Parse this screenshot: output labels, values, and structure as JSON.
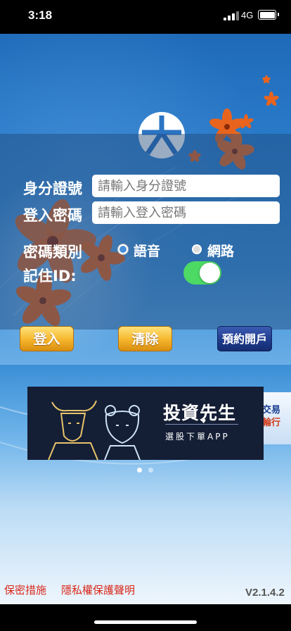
{
  "status_bar": {
    "time": "3:18",
    "network": "4G"
  },
  "login": {
    "id_label": "身分證號",
    "id_placeholder": "請輸入身分證號",
    "password_label": "登入密碼",
    "password_placeholder": "請輸入登入密碼",
    "password_type_label": "密碼類別",
    "password_type_options": [
      {
        "label": "語音",
        "selected": true
      },
      {
        "label": "網路",
        "selected": false
      }
    ],
    "remember_id_label": "記住ID:",
    "remember_id_on": true
  },
  "buttons": {
    "login": "登入",
    "clear": "清除",
    "book_account": "預約開戶"
  },
  "banner": {
    "title": "投資先生",
    "subtitle": "選股下單APP"
  },
  "side_card": {
    "line1": "交易",
    "line2": "輪行"
  },
  "carousel": {
    "count": 2,
    "active_index": 0
  },
  "footer": {
    "security_link": "保密措施",
    "privacy_link": "隱私權保護聲明",
    "version": "V2.1.4.2"
  },
  "colors": {
    "accent_gold": "#f5b52b",
    "accent_blue": "#1d3a8a",
    "toggle_on": "#4cd964",
    "link_red": "#d9281a"
  },
  "icons": [
    "signal-icon",
    "battery-icon",
    "logo-icon",
    "bull-icon",
    "bear-icon",
    "flower-icon"
  ]
}
